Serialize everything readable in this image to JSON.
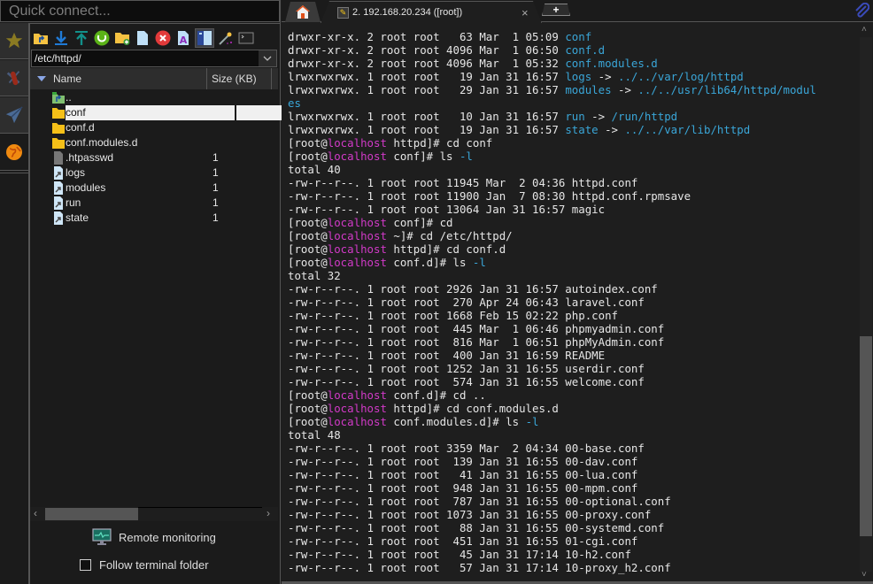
{
  "quick_connect": {
    "placeholder": "Quick connect..."
  },
  "sidebar": {
    "items": [
      {
        "icon": "star-icon",
        "label": "Favorites"
      },
      {
        "icon": "tools-icon",
        "label": "Tools"
      },
      {
        "icon": "paper-plane-icon",
        "label": "Send"
      },
      {
        "icon": "globe-icon",
        "label": "SFTP"
      }
    ]
  },
  "file_browser": {
    "toolbar": [
      {
        "icon": "folder-up-icon",
        "label": "Parent directory"
      },
      {
        "icon": "download-icon",
        "label": "Download"
      },
      {
        "icon": "upload-icon",
        "label": "Upload"
      },
      {
        "icon": "refresh-icon",
        "label": "Refresh"
      },
      {
        "icon": "new-folder-icon",
        "label": "New folder"
      },
      {
        "icon": "new-file-icon",
        "label": "New file"
      },
      {
        "icon": "delete-icon",
        "label": "Delete"
      },
      {
        "icon": "rename-icon",
        "label": "Rename"
      },
      {
        "icon": "split-view-icon",
        "label": "Split view",
        "pressed": true
      },
      {
        "icon": "magic-wand-icon",
        "label": "Tools"
      },
      {
        "icon": "terminal-icon",
        "label": "Open terminal"
      }
    ],
    "path": "/etc/httpd/",
    "columns": {
      "name": "Name",
      "size": "Size (KB)"
    },
    "files": [
      {
        "name": "..",
        "type": "parent",
        "size": ""
      },
      {
        "name": "conf",
        "type": "folder",
        "size": "",
        "selected": true
      },
      {
        "name": "conf.d",
        "type": "folder",
        "size": ""
      },
      {
        "name": "conf.modules.d",
        "type": "folder",
        "size": ""
      },
      {
        "name": ".htpasswd",
        "type": "file",
        "size": "1"
      },
      {
        "name": "logs",
        "type": "link",
        "size": "1"
      },
      {
        "name": "modules",
        "type": "link",
        "size": "1"
      },
      {
        "name": "run",
        "type": "link",
        "size": "1"
      },
      {
        "name": "state",
        "type": "link",
        "size": "1"
      }
    ],
    "remote_monitoring": "Remote monitoring",
    "follow_terminal": {
      "label": "Follow terminal folder",
      "checked": false
    }
  },
  "tabs": {
    "home_label": "Home",
    "session_label": "2. 192.168.20.234 ([root])",
    "close_glyph": "×",
    "new_tab_glyph": "+"
  },
  "colors": {
    "link": "#3aa6d8",
    "host": "#d23ac8",
    "text": "#e6e6e6",
    "background": "#1e1e1e"
  },
  "terminal": {
    "lines": [
      [
        {
          "t": "drwxr-xr-x. 2 root root   63 Mar  1 05:09 "
        },
        {
          "t": "conf",
          "c": "link"
        }
      ],
      [
        {
          "t": "drwxr-xr-x. 2 root root 4096 Mar  1 06:50 "
        },
        {
          "t": "conf.d",
          "c": "link"
        }
      ],
      [
        {
          "t": "drwxr-xr-x. 2 root root 4096 Mar  1 05:32 "
        },
        {
          "t": "conf.modules.d",
          "c": "link"
        }
      ],
      [
        {
          "t": "lrwxrwxrwx. 1 root root   19 Jan 31 16:57 "
        },
        {
          "t": "logs",
          "c": "link"
        },
        {
          "t": " -> "
        },
        {
          "t": "../../var/log/httpd",
          "c": "link"
        }
      ],
      [
        {
          "t": "lrwxrwxrwx. 1 root root   29 Jan 31 16:57 "
        },
        {
          "t": "modules",
          "c": "link"
        },
        {
          "t": " -> "
        },
        {
          "t": "../../usr/lib64/httpd/modul",
          "c": "link"
        }
      ],
      [
        {
          "t": "es",
          "c": "link"
        }
      ],
      [
        {
          "t": "lrwxrwxrwx. 1 root root   10 Jan 31 16:57 "
        },
        {
          "t": "run",
          "c": "link"
        },
        {
          "t": " -> "
        },
        {
          "t": "/run/httpd",
          "c": "link"
        }
      ],
      [
        {
          "t": "lrwxrwxrwx. 1 root root   19 Jan 31 16:57 "
        },
        {
          "t": "state",
          "c": "link"
        },
        {
          "t": " -> "
        },
        {
          "t": "../../var/lib/httpd",
          "c": "link"
        }
      ],
      [
        {
          "t": "[root@"
        },
        {
          "t": "localhost",
          "c": "host"
        },
        {
          "t": " httpd]# cd conf"
        }
      ],
      [
        {
          "t": "[root@"
        },
        {
          "t": "localhost",
          "c": "host"
        },
        {
          "t": " conf]# ls "
        },
        {
          "t": "-l",
          "c": "flag"
        }
      ],
      [
        {
          "t": "total 40"
        }
      ],
      [
        {
          "t": "-rw-r--r--. 1 root root 11945 Mar  2 04:36 httpd.conf"
        }
      ],
      [
        {
          "t": "-rw-r--r--. 1 root root 11900 Jan  7 08:30 httpd.conf.rpmsave"
        }
      ],
      [
        {
          "t": "-rw-r--r--. 1 root root 13064 Jan 31 16:57 magic"
        }
      ],
      [
        {
          "t": "[root@"
        },
        {
          "t": "localhost",
          "c": "host"
        },
        {
          "t": " conf]# cd"
        }
      ],
      [
        {
          "t": "[root@"
        },
        {
          "t": "localhost",
          "c": "host"
        },
        {
          "t": " ~]# cd /etc/httpd/"
        }
      ],
      [
        {
          "t": "[root@"
        },
        {
          "t": "localhost",
          "c": "host"
        },
        {
          "t": " httpd]# cd conf.d"
        }
      ],
      [
        {
          "t": "[root@"
        },
        {
          "t": "localhost",
          "c": "host"
        },
        {
          "t": " conf.d]# ls "
        },
        {
          "t": "-l",
          "c": "flag"
        }
      ],
      [
        {
          "t": "total 32"
        }
      ],
      [
        {
          "t": "-rw-r--r--. 1 root root 2926 Jan 31 16:57 autoindex.conf"
        }
      ],
      [
        {
          "t": "-rw-r--r--. 1 root root  270 Apr 24 06:43 laravel.conf"
        }
      ],
      [
        {
          "t": "-rw-r--r--. 1 root root 1668 Feb 15 02:22 php.conf"
        }
      ],
      [
        {
          "t": "-rw-r--r--. 1 root root  445 Mar  1 06:46 phpmyadmin.conf"
        }
      ],
      [
        {
          "t": "-rw-r--r--. 1 root root  816 Mar  1 06:51 phpMyAdmin.conf"
        }
      ],
      [
        {
          "t": "-rw-r--r--. 1 root root  400 Jan 31 16:59 README"
        }
      ],
      [
        {
          "t": "-rw-r--r--. 1 root root 1252 Jan 31 16:55 userdir.conf"
        }
      ],
      [
        {
          "t": "-rw-r--r--. 1 root root  574 Jan 31 16:55 welcome.conf"
        }
      ],
      [
        {
          "t": "[root@"
        },
        {
          "t": "localhost",
          "c": "host"
        },
        {
          "t": " conf.d]# cd .."
        }
      ],
      [
        {
          "t": "[root@"
        },
        {
          "t": "localhost",
          "c": "host"
        },
        {
          "t": " httpd]# cd conf.modules.d"
        }
      ],
      [
        {
          "t": "[root@"
        },
        {
          "t": "localhost",
          "c": "host"
        },
        {
          "t": " conf.modules.d]# ls "
        },
        {
          "t": "-l",
          "c": "flag"
        }
      ],
      [
        {
          "t": "total 48"
        }
      ],
      [
        {
          "t": "-rw-r--r--. 1 root root 3359 Mar  2 04:34 00-base.conf"
        }
      ],
      [
        {
          "t": "-rw-r--r--. 1 root root  139 Jan 31 16:55 00-dav.conf"
        }
      ],
      [
        {
          "t": "-rw-r--r--. 1 root root   41 Jan 31 16:55 00-lua.conf"
        }
      ],
      [
        {
          "t": "-rw-r--r--. 1 root root  948 Jan 31 16:55 00-mpm.conf"
        }
      ],
      [
        {
          "t": "-rw-r--r--. 1 root root  787 Jan 31 16:55 00-optional.conf"
        }
      ],
      [
        {
          "t": "-rw-r--r--. 1 root root 1073 Jan 31 16:55 00-proxy.conf"
        }
      ],
      [
        {
          "t": "-rw-r--r--. 1 root root   88 Jan 31 16:55 00-systemd.conf"
        }
      ],
      [
        {
          "t": "-rw-r--r--. 1 root root  451 Jan 31 16:55 01-cgi.conf"
        }
      ],
      [
        {
          "t": "-rw-r--r--. 1 root root   45 Jan 31 17:14 10-h2.conf"
        }
      ],
      [
        {
          "t": "-rw-r--r--. 1 root root   57 Jan 31 17:14 10-proxy_h2.conf"
        }
      ]
    ]
  }
}
